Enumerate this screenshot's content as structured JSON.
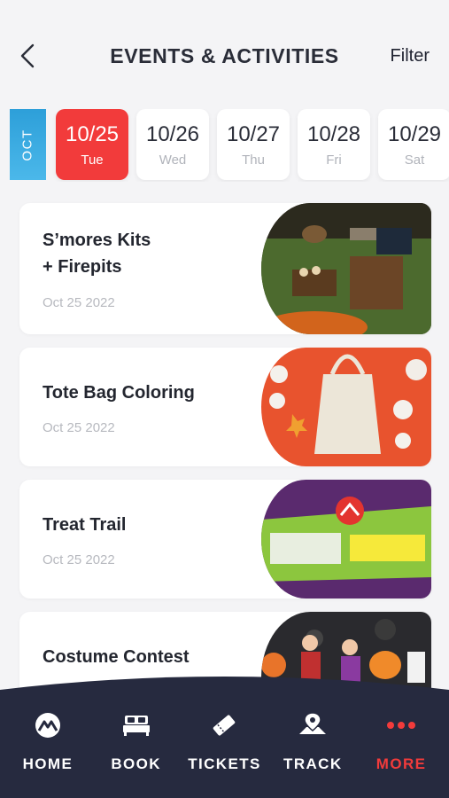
{
  "header": {
    "title": "EVENTS & ACTIVITIES",
    "filter_label": "Filter"
  },
  "date_strip": {
    "month": "OCT",
    "days": [
      {
        "date": "10/25",
        "weekday": "Tue",
        "selected": true
      },
      {
        "date": "10/26",
        "weekday": "Wed",
        "selected": false
      },
      {
        "date": "10/27",
        "weekday": "Thu",
        "selected": false
      },
      {
        "date": "10/28",
        "weekday": "Fri",
        "selected": false
      },
      {
        "date": "10/29",
        "weekday": "Sat",
        "selected": false
      }
    ]
  },
  "events": [
    {
      "title_line1": "S’mores Kits",
      "title_line2": "+ Firepits",
      "date": "Oct 25 2022"
    },
    {
      "title_line1": "Tote Bag Coloring",
      "date": "Oct 25 2022"
    },
    {
      "title_line1": "Treat Trail",
      "date": "Oct 25 2022"
    },
    {
      "title_line1": "Costume Contest"
    }
  ],
  "nav": {
    "items": [
      {
        "label": "HOME",
        "icon": "mountain-logo-icon",
        "active": false
      },
      {
        "label": "BOOK",
        "icon": "bed-icon",
        "active": false
      },
      {
        "label": "TICKETS",
        "icon": "ticket-icon",
        "active": false
      },
      {
        "label": "TRACK",
        "icon": "map-pin-icon",
        "active": false
      },
      {
        "label": "MORE",
        "icon": "more-dots-icon",
        "active": true
      }
    ]
  },
  "colors": {
    "accent_red": "#f23b3b",
    "month_blue": "#3aaee4",
    "nav_bg": "#262a3f"
  }
}
